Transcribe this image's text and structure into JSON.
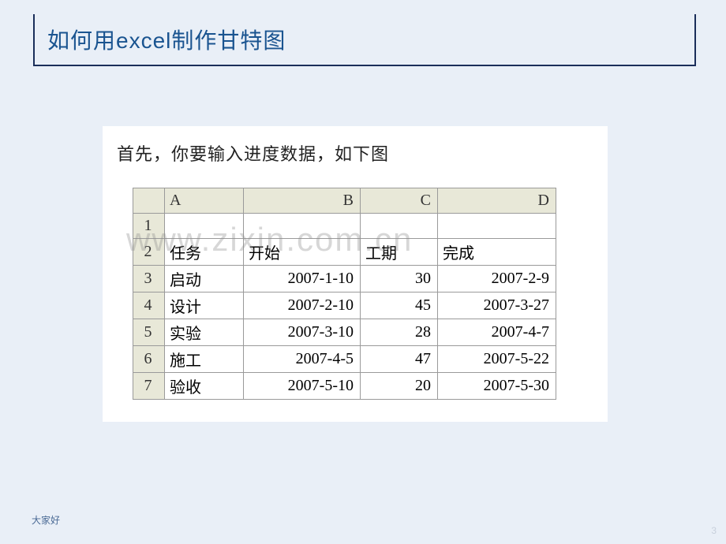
{
  "title": "如何用excel制作甘特图",
  "instruction": "首先，你要输入进度数据，如下图",
  "watermark": "www.zixin.com.cn",
  "footer": "大家好",
  "page_number": "3",
  "table": {
    "col_letters": [
      "A",
      "B",
      "C",
      "D"
    ],
    "row_numbers": [
      "1",
      "2",
      "3",
      "4",
      "5",
      "6",
      "7"
    ],
    "headers": {
      "A": "任务",
      "B": "开始",
      "C": "工期",
      "D": "完成"
    },
    "rows": [
      {
        "A": "启动",
        "B": "2007-1-10",
        "C": "30",
        "D": "2007-2-9"
      },
      {
        "A": "设计",
        "B": "2007-2-10",
        "C": "45",
        "D": "2007-3-27"
      },
      {
        "A": "实验",
        "B": "2007-3-10",
        "C": "28",
        "D": "2007-4-7"
      },
      {
        "A": "施工",
        "B": "2007-4-5",
        "C": "47",
        "D": "2007-5-22"
      },
      {
        "A": "验收",
        "B": "2007-5-10",
        "C": "20",
        "D": "2007-5-30"
      }
    ]
  }
}
